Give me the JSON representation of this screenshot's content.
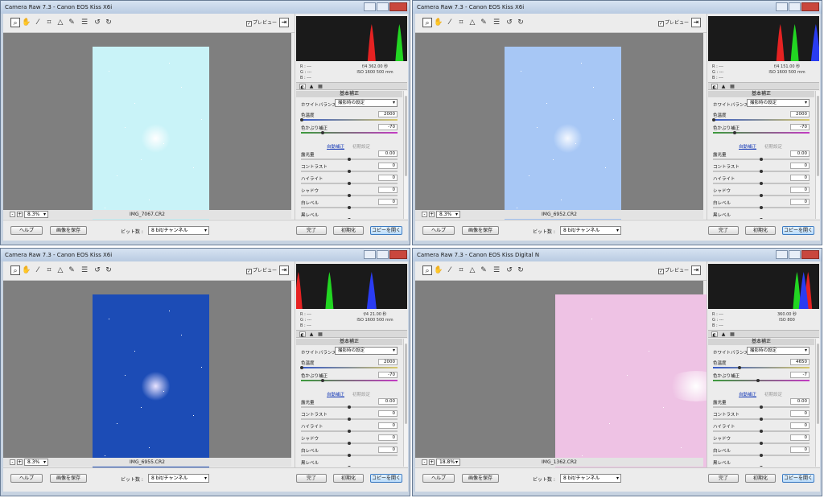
{
  "preview_label": "プレビュー",
  "common": {
    "wb_label": "ホワイトバランス :",
    "wb_value": "撮影時の設定",
    "temp_label": "色温度",
    "tint_label": "色かぶり補正",
    "auto_label": "自動補正",
    "default_label": "初期設定",
    "exposure_label": "露光量",
    "contrast_label": "コントラスト",
    "highlights_label": "ハイライト",
    "shadows_label": "シャドウ",
    "whites_label": "白レベル",
    "blacks_label": "黒レベル",
    "panel_header": "基本補正",
    "help_button": "ヘルプ",
    "save_button": "画像を保存",
    "bitdepth_label": "ビット数 :",
    "bitdepth_value": "8 bit/チャンネル",
    "done_button": "完了",
    "reset_button": "初期化",
    "copy_button": "コピーを開く",
    "r_label": "R :  ---",
    "g_label": "G :  ---",
    "b_label": "B :  ---",
    "zoom_minus": "-",
    "zoom_plus": "+"
  },
  "windows": [
    {
      "title": "Camera Raw 7.3  -  Canon EOS Kiss X6i",
      "filename": "IMG_7067.CR2",
      "zoom": "8.3%",
      "exif_line1": "f/4    362.00 秒",
      "exif_line2": "ISO 1600    500 mm",
      "temperature": "2000",
      "tint": "-70",
      "exposure": "0.00",
      "contrast": "0",
      "highlights": "0",
      "shadows": "0",
      "whites": "0",
      "temp_fraction": 0.0,
      "tint_fraction": 0.22,
      "photo_color": "#c9f3f8",
      "glow_color": "#ffffff",
      "histogram": {
        "red_peak": 0.68,
        "green_peak": 0.93,
        "blue_peak": null
      }
    },
    {
      "title": "Camera Raw 7.3  -  Canon EOS Kiss X6i",
      "filename": "IMG_6952.CR2",
      "zoom": "8.3%",
      "exif_line1": "f/4    151.00 秒",
      "exif_line2": "ISO 1600    500 mm",
      "temperature": "2000",
      "tint": "-70",
      "exposure": "0.00",
      "contrast": "0",
      "highlights": "0",
      "shadows": "0",
      "whites": "0",
      "temp_fraction": 0.0,
      "tint_fraction": 0.22,
      "photo_color": "#a7c7f5",
      "glow_color": "#f4f8ff",
      "histogram": {
        "red_peak": 0.65,
        "green_peak": 0.78,
        "blue_peak": 0.97
      }
    },
    {
      "title": "Camera Raw 7.3  -  Canon EOS Kiss X6i",
      "filename": "IMG_6955.CR2",
      "zoom": "8.3%",
      "exif_line1": "f/4    21.00 秒",
      "exif_line2": "ISO 1600    500 mm",
      "temperature": "2000",
      "tint": "-70",
      "exposure": "0.00",
      "contrast": "0",
      "highlights": "0",
      "shadows": "0",
      "whites": "0",
      "temp_fraction": 0.0,
      "tint_fraction": 0.22,
      "photo_color": "#1c4cb6",
      "glow_color": "#e9e3ff",
      "histogram": {
        "red_peak": 0.02,
        "green_peak": 0.3,
        "blue_peak": 0.68
      }
    },
    {
      "title": "Camera Raw 7.3  -  Canon EOS Kiss Digital N",
      "filename": "IMG_1362.CR2",
      "zoom": "18.8%",
      "exif_line1": "360.00 秒",
      "exif_line2": "ISO 800",
      "temperature": "4650",
      "tint": "-7",
      "exposure": "0.00",
      "contrast": "0",
      "highlights": "0",
      "shadows": "0",
      "whites": "0",
      "temp_fraction": 0.27,
      "tint_fraction": 0.47,
      "photo_color": "#eec2e4",
      "glow_color": "#ffffff",
      "histogram": {
        "red_peak": 0.9,
        "green_peak": 0.8,
        "blue_peak": 0.86
      }
    }
  ]
}
